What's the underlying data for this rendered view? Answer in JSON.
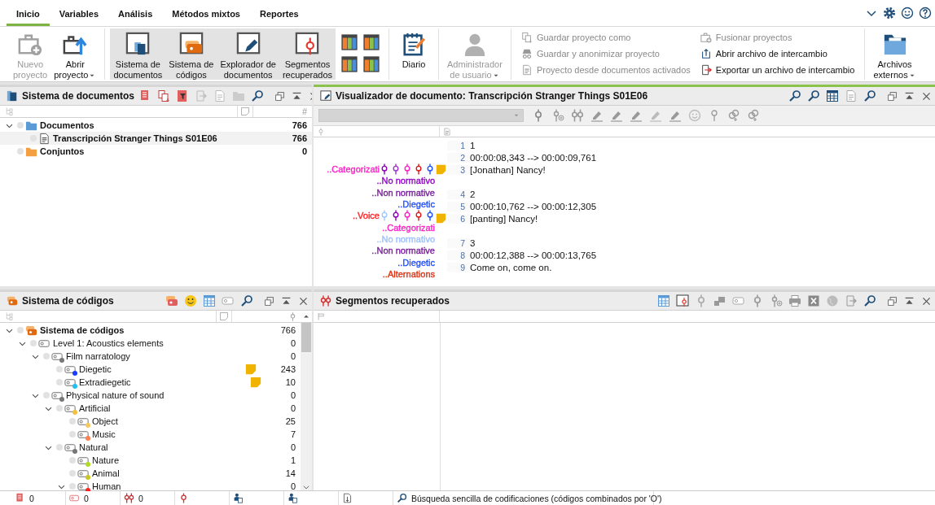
{
  "tabs": [
    {
      "label": "Inicio",
      "selected": true
    },
    {
      "label": "Variables",
      "selected": false
    },
    {
      "label": "Análisis",
      "selected": false
    },
    {
      "label": "Métodos mixtos",
      "selected": false
    },
    {
      "label": "Reportes",
      "selected": false
    }
  ],
  "ribbon": [
    {
      "kind": "large",
      "buttons": [
        {
          "lines": [
            "Nuevo",
            "proyecto"
          ],
          "disabled": true,
          "dropdown": false,
          "selected": false
        },
        {
          "lines": [
            "Abrir",
            "proyecto"
          ],
          "disabled": false,
          "dropdown": true,
          "selected": false
        }
      ]
    },
    {
      "kind": "large",
      "buttons": [
        {
          "lines": [
            "Sistema de",
            "documentos"
          ],
          "disabled": false,
          "dropdown": false,
          "selected": true
        },
        {
          "lines": [
            "Sistema de",
            "códigos"
          ],
          "disabled": false,
          "dropdown": false,
          "selected": true
        },
        {
          "lines": [
            "Explorador de",
            "documentos"
          ],
          "disabled": false,
          "dropdown": false,
          "selected": true
        },
        {
          "lines": [
            "Segmentos",
            "recuperados"
          ],
          "disabled": false,
          "dropdown": false,
          "selected": true
        }
      ]
    },
    {
      "kind": "layouts"
    },
    {
      "kind": "large",
      "buttons": [
        {
          "lines": [
            "Diario"
          ],
          "disabled": false,
          "dropdown": false,
          "selected": false
        }
      ]
    },
    {
      "kind": "large",
      "buttons": [
        {
          "lines": [
            "Administrador",
            "de usuario"
          ],
          "disabled": true,
          "dropdown": true,
          "selected": false
        }
      ]
    },
    {
      "kind": "small",
      "items": [
        {
          "label": "Guardar proyecto como",
          "disabled": true
        },
        {
          "label": "Guardar y anonimizar proyecto",
          "disabled": true
        },
        {
          "label": "Proyecto desde documentos activados",
          "disabled": true
        }
      ]
    },
    {
      "kind": "small",
      "items": [
        {
          "label": "Fusionar proyectos",
          "disabled": true
        },
        {
          "label": "Abrir archivo de intercambio",
          "disabled": false
        },
        {
          "label": "Exportar un archivo de intercambio",
          "disabled": false
        }
      ]
    },
    {
      "kind": "large",
      "buttons": [
        {
          "lines": [
            "Archivos",
            "externos"
          ],
          "disabled": false,
          "dropdown": true,
          "selected": false
        }
      ]
    }
  ],
  "documents": {
    "title": "Sistema de documentos",
    "count_header": "#",
    "tree": [
      {
        "kind": "folder",
        "label": "Documentos",
        "count": "766",
        "selected": false,
        "expanded": true,
        "children": [
          {
            "kind": "document",
            "label": "Transcripción Stranger Things S01E06",
            "count": "766",
            "selected": true
          }
        ]
      },
      {
        "kind": "sets",
        "label": "Conjuntos",
        "count": "0",
        "selected": false
      }
    ]
  },
  "viewer": {
    "title": "Visualizador de documento: Transcripción Stranger Things S01E06",
    "active": true,
    "margin": [
      {
        "label": "..Categorizati",
        "color": "#ff1fc8",
        "stripes": [
          {
            "color": "#8a00b8"
          },
          {
            "color": "#a030d0"
          },
          {
            "color": "#ff1fc8"
          },
          {
            "color": "#e01818"
          },
          {
            "color": "#2050ff"
          }
        ]
      },
      {
        "label": "..No normativo",
        "color": "#9400c8"
      },
      {
        "label": "..Non normative",
        "color": "#7a1c9c"
      },
      {
        "label": "..Diegetic",
        "color": "#2050ff"
      },
      {
        "label": "..Voice",
        "color": "#ff2020",
        "stripes": [
          {
            "color": "#9cc8ff"
          },
          {
            "color": "#8a00b8"
          },
          {
            "color": "#ff1fc8"
          },
          {
            "color": "#e01818"
          },
          {
            "color": "#2050ff"
          }
        ]
      },
      {
        "label": "..Categorizati",
        "color": "#ff1fc8"
      },
      {
        "label": "..No normativo",
        "color": "#9cc0ff"
      },
      {
        "label": "..Non normative",
        "color": "#7a1c9c"
      },
      {
        "label": "..Diegetic",
        "color": "#2050ff"
      },
      {
        "label": "..Alternations",
        "color": "#e03010"
      }
    ],
    "paragraphs": [
      {
        "lines": [
          {
            "number": "1",
            "text": "1",
            "memo": false
          },
          {
            "number": "2",
            "text": "00:00:08,343 --> 00:00:09,761",
            "memo": false
          },
          {
            "number": "3",
            "text": "[Jonathan] Nancy!",
            "memo": true
          }
        ]
      },
      {
        "lines": [
          {
            "number": "4",
            "text": "2",
            "memo": false
          },
          {
            "number": "5",
            "text": "00:00:10,762 --> 00:00:12,305",
            "memo": false
          },
          {
            "number": "6",
            "text": "[panting] Nancy!",
            "memo": true
          }
        ]
      },
      {
        "lines": [
          {
            "number": "7",
            "text": "3",
            "memo": false
          },
          {
            "number": "8",
            "text": "00:00:12,388 --> 00:00:13,765",
            "memo": false
          },
          {
            "number": "9",
            "text": "Come on, come on.",
            "memo": false
          }
        ]
      }
    ]
  },
  "codes": {
    "title": "Sistema de códigos",
    "tree": [
      {
        "kind": "root",
        "label": "Sistema de códigos",
        "count": "766",
        "memo": false,
        "expanded": true,
        "children": [
          {
            "kind": "code",
            "label": "Level 1: Acoustics elements",
            "count": "0",
            "memo": false,
            "expanded": true,
            "children": [
              {
                "kind": "code",
                "label": "Film narratology",
                "count": "0",
                "color": "#777777",
                "memo": false,
                "expanded": true,
                "children": [
                  {
                    "kind": "code",
                    "label": "Diegetic",
                    "count": "243",
                    "color": "#1a3cff",
                    "memo": true
                  },
                  {
                    "kind": "code",
                    "label": "Extradiegetic",
                    "count": "10",
                    "color": "#20c0f0",
                    "memo": true
                  }
                ]
              },
              {
                "kind": "code",
                "label": "Physical nature of sound",
                "count": "0",
                "color": "#777777",
                "memo": false,
                "expanded": true,
                "children": [
                  {
                    "kind": "code",
                    "label": "Artificial",
                    "count": "0",
                    "color": "#f5c040",
                    "memo": false,
                    "expanded": true,
                    "children": [
                      {
                        "kind": "code",
                        "label": "Object",
                        "count": "25",
                        "color": "#f8c860",
                        "memo": false
                      },
                      {
                        "kind": "code",
                        "label": "Music",
                        "count": "7",
                        "color": "#ff7f50",
                        "memo": false
                      }
                    ]
                  },
                  {
                    "kind": "code",
                    "label": "Natural",
                    "count": "0",
                    "color": "#777777",
                    "memo": false,
                    "expanded": true,
                    "children": [
                      {
                        "kind": "code",
                        "label": "Nature",
                        "count": "1",
                        "color": "#b0dc20",
                        "memo": false
                      },
                      {
                        "kind": "code",
                        "label": "Animal",
                        "count": "14",
                        "color": "#c8c820",
                        "memo": false
                      },
                      {
                        "kind": "code",
                        "label": "Human",
                        "count": "0",
                        "color": "#ff2020",
                        "memo": false,
                        "expanded": true
                      }
                    ]
                  }
                ]
              }
            ]
          }
        ]
      }
    ]
  },
  "segments": {
    "title": "Segmentos recuperados"
  },
  "status_bar": [
    {
      "kind": "counter",
      "count": "0"
    },
    {
      "kind": "counter",
      "count": "0"
    },
    {
      "kind": "counter",
      "count": "0"
    },
    {
      "kind": "icon"
    },
    {
      "kind": "icon"
    },
    {
      "kind": "icon"
    },
    {
      "kind": "icon"
    },
    {
      "kind": "message",
      "text": "Búsqueda sencilla de codificaciones (códigos combinados por 'O')"
    }
  ]
}
